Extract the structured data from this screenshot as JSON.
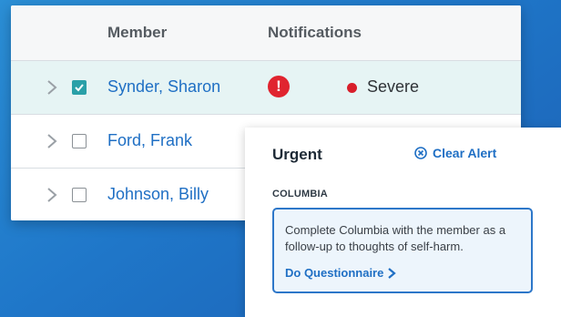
{
  "table": {
    "headers": {
      "member": "Member",
      "notifications": "Notifications"
    },
    "rows": [
      {
        "name": "Synder, Sharon",
        "checked": true,
        "severity": "Severe"
      },
      {
        "name": "Ford, Frank",
        "checked": false
      },
      {
        "name": "Johnson, Billy",
        "checked": false
      }
    ]
  },
  "alert_icon_glyph": "!",
  "popover": {
    "title": "Urgent",
    "clear_label": "Clear Alert",
    "section": "COLUMBIA",
    "message": "Complete Columbia with the member as a follow-up to thoughts of self-harm.",
    "action_label": "Do Questionnaire"
  },
  "colors": {
    "accent_blue": "#1f6fc4",
    "severe_red": "#d81e2a",
    "checkbox_teal": "#2aa0a8",
    "selected_row": "#e6f4f4"
  }
}
